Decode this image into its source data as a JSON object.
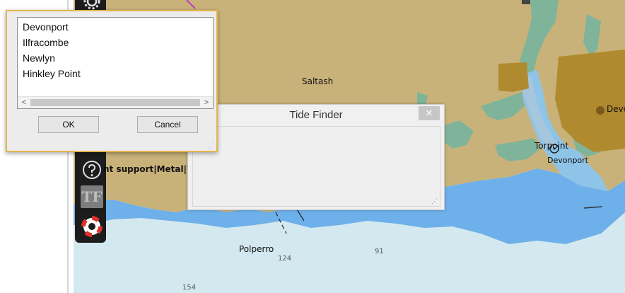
{
  "map": {
    "place_labels": [
      "Saltash",
      "Torpoint",
      "Devonport",
      "Devon",
      "Polperro"
    ],
    "soundings": [
      "124",
      "91",
      "154"
    ],
    "colors": {
      "land": "#c9b27a",
      "land_dark": "#b08a2e",
      "shallow": "#7fb49a",
      "water": "#6db0ea",
      "deep": "#d3e8ef"
    }
  },
  "toolbar": {
    "support_text": "nt support|Metal|Ver",
    "icons": [
      "gear-icon",
      "help-icon",
      "tide-finder-icon",
      "lifebuoy-icon"
    ],
    "tf_label": "TF"
  },
  "tide_finder": {
    "title": "Tide Finder",
    "close_label": "✕"
  },
  "port_dialog": {
    "ports": [
      "Devonport",
      "Ilfracombe",
      "Newlyn",
      "Hinkley Point"
    ],
    "ok_label": "OK",
    "cancel_label": "Cancel",
    "scroll_left": "<",
    "scroll_right": ">"
  }
}
